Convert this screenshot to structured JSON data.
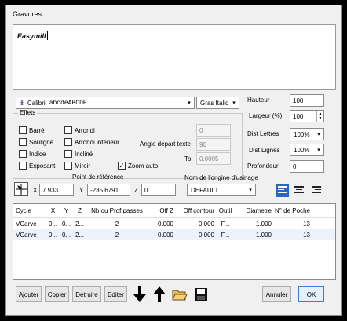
{
  "window": {
    "title": "Gravures"
  },
  "editor": {
    "text": "Easymill"
  },
  "font": {
    "name": "Calibri",
    "sample": "abcdeABCDE",
    "style": "Gras Italiq"
  },
  "size": {
    "hauteur_label": "Hauteur",
    "hauteur": "100",
    "largeur_label": "Largeur (%)",
    "largeur": "100",
    "dist_lettres_label": "Dist Lettres",
    "dist_lettres": "100%",
    "dist_lignes_label": "Dist Lignes",
    "dist_lignes": "100%",
    "profondeur_label": "Profondeur",
    "profondeur": "0"
  },
  "effets": {
    "title": "Effets",
    "barre": "Barré",
    "souligne": "Souligné",
    "indice": "Indice",
    "exposant": "Exposant",
    "arrondi": "Arrondi",
    "arrondi_interieur": "Arrondi interieur",
    "incline": "Incliné",
    "miroir": "Miroir",
    "zoom_auto": "Zoom auto",
    "zoom_auto_checked": "✓",
    "field_top": "0",
    "angle_label": "Angle départ texte",
    "angle": "90",
    "tol_label": "Tol",
    "tol": "0.0005"
  },
  "reference": {
    "title": "Point de référence",
    "x_label": "X",
    "x": "7.933",
    "y_label": "Y",
    "y": "-235.6791",
    "z_label": "Z",
    "z": "0"
  },
  "origin": {
    "title": "Nom de l'origine d'usinage",
    "value": "DEFAULT"
  },
  "table": {
    "headers": [
      "Cycle",
      "X",
      "Y",
      "Z",
      "Nb ou Prof passes",
      "Off Z",
      "Off contour",
      "Outil",
      "Diametre",
      "N° de Poche"
    ],
    "rows": [
      [
        "VCarve",
        "0...",
        "0...",
        "2...",
        "2",
        "0.000",
        "0.000",
        "F...",
        "1.000",
        "13"
      ],
      [
        "VCarve",
        "0...",
        "0...",
        "2...",
        "2",
        "0.000",
        "0.000",
        "F...",
        "1.000",
        "13"
      ]
    ]
  },
  "buttons": {
    "ajouter": "Ajouter",
    "copier": "Copier",
    "detruire": "Detruire",
    "editer": "Editer",
    "annuler": "Annuler",
    "ok": "OK"
  },
  "icons": [
    "arrow-down-icon",
    "arrow-up-icon",
    "folder-open-icon",
    "save-icon",
    "cursor-target-icon"
  ],
  "colors": {
    "accent": "#2a64c8",
    "font_icon": "#7a2fa0",
    "selected_row": "#eef3fb"
  }
}
